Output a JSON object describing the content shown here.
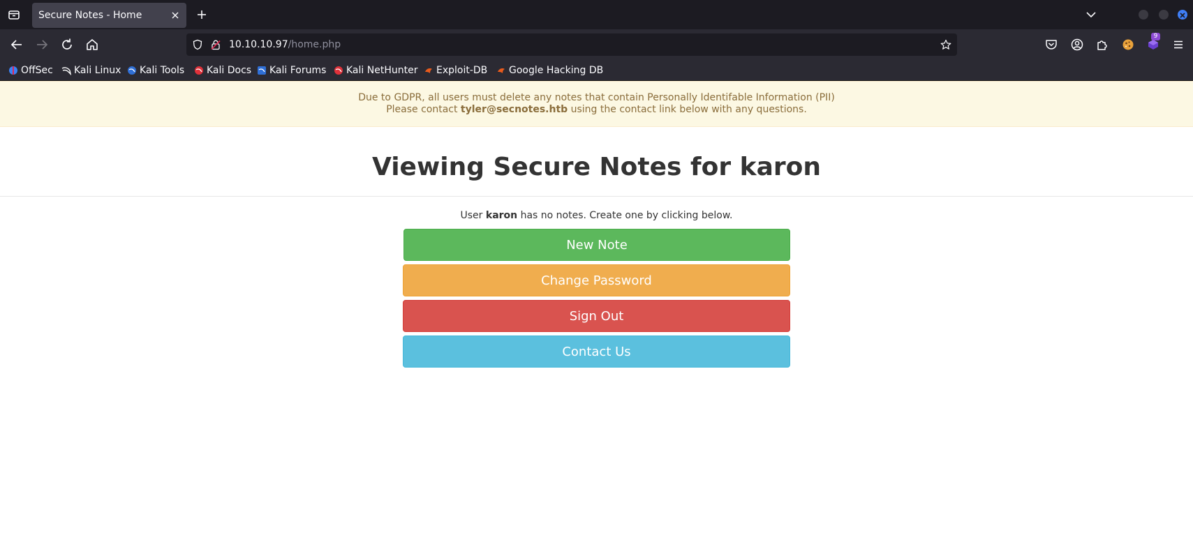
{
  "browser": {
    "tab": {
      "title": "Secure Notes - Home"
    },
    "url": {
      "host": "10.10.10.97",
      "path": "/home.php"
    },
    "extension_badge": "9",
    "bookmarks": [
      {
        "label": "OffSec",
        "icon": "offsec-icon",
        "color": "#3b82f6"
      },
      {
        "label": "Kali Linux",
        "icon": "kali-icon",
        "color": "#ffffff"
      },
      {
        "label": "Kali Tools",
        "icon": "kali-tools-icon",
        "color": "#2f6fd6"
      },
      {
        "label": "Kali Docs",
        "icon": "kali-docs-icon",
        "color": "#e0313a"
      },
      {
        "label": "Kali Forums",
        "icon": "kali-forums-icon",
        "color": "#2f6fd6"
      },
      {
        "label": "Kali NetHunter",
        "icon": "kali-nethunter-icon",
        "color": "#e0313a"
      },
      {
        "label": "Exploit-DB",
        "icon": "exploit-db-icon",
        "color": "#ea5b1c"
      },
      {
        "label": "Google Hacking DB",
        "icon": "ghdb-icon",
        "color": "#ea5b1c"
      }
    ]
  },
  "page": {
    "gdpr": {
      "line1": "Due to GDPR, all users must delete any notes that contain Personally Identifable Information (PII)",
      "line2_prefix": "Please contact ",
      "email": "tyler@secnotes.htb",
      "line2_suffix": " using the contact link below with any questions."
    },
    "title_prefix": "Viewing Secure Notes for ",
    "username": "karon",
    "notice_prefix": "User ",
    "notice_suffix": " has no notes. Create one by clicking below.",
    "buttons": {
      "new_note": "New Note",
      "change_password": "Change Password",
      "sign_out": "Sign Out",
      "contact_us": "Contact Us"
    },
    "colors": {
      "success": "#5cb85c",
      "warning": "#f0ad4e",
      "danger": "#d9534f",
      "info": "#5bc0de"
    }
  }
}
